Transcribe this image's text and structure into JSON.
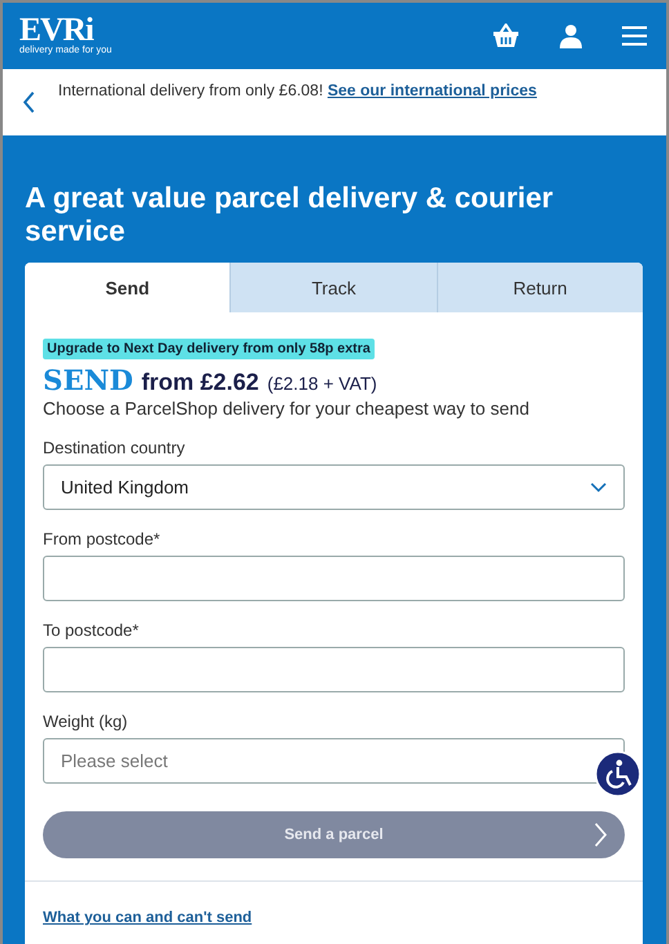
{
  "header": {
    "logo": "EVRi",
    "tagline": "delivery made for you"
  },
  "banner": {
    "text": "International delivery from only £6.08!",
    "link": "See our international prices"
  },
  "heading": "A great value parcel delivery & courier service",
  "tabs": [
    {
      "label": "Send",
      "selected": true
    },
    {
      "label": "Track",
      "selected": false
    },
    {
      "label": "Return",
      "selected": false
    }
  ],
  "promo": "Upgrade to Next Day delivery from only 58p extra",
  "price": {
    "brand": "SEND",
    "price": "from £2.62",
    "vat": "(£2.18 + VAT)"
  },
  "intro": "Choose a ParcelShop delivery for your cheapest way to send",
  "fields": [
    {
      "kind": "select",
      "label": "Destination country",
      "value": "United Kingdom"
    },
    {
      "kind": "text",
      "label": "From postcode*"
    },
    {
      "kind": "text",
      "label": "To postcode*"
    },
    {
      "kind": "select-placeholder",
      "label": "Weight (kg)",
      "placeholder": "Please select"
    }
  ],
  "submit": {
    "label": "Send a parcel",
    "disabled": true
  },
  "footer_link": "What you can and can't send"
}
